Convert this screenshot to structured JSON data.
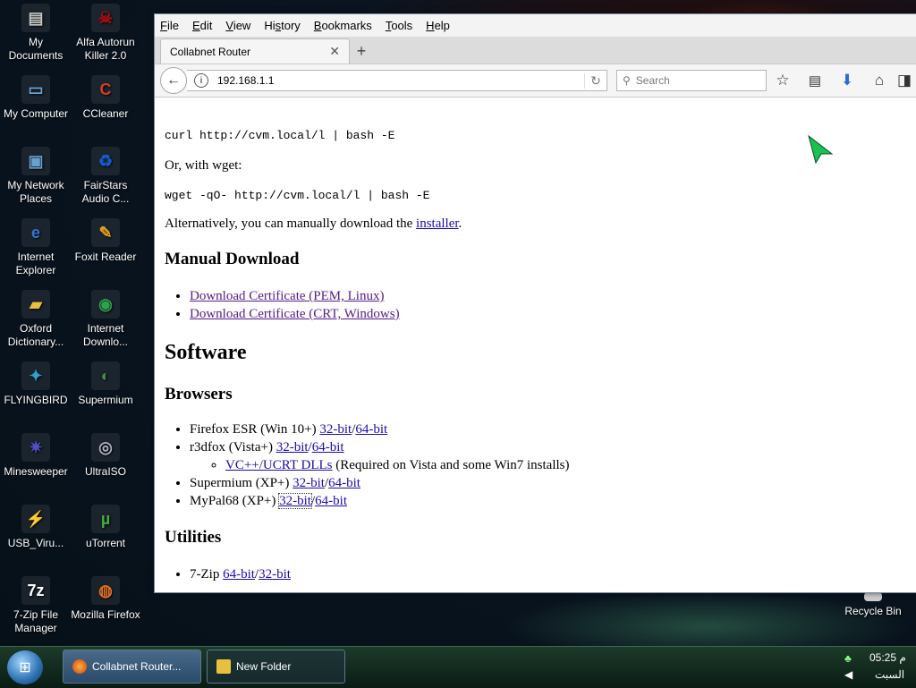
{
  "desktop": {
    "icons": [
      {
        "label": "My Documents",
        "icon": "folder-documents-icon",
        "color": "#c9c9c9"
      },
      {
        "label": "Alfa Autorun Killer 2.0",
        "icon": "virus-killer-icon",
        "color": "#a01010"
      },
      {
        "label": "My Computer",
        "icon": "computer-icon",
        "color": "#6aa0d0"
      },
      {
        "label": "CCleaner",
        "icon": "ccleaner-icon",
        "color": "#d04020"
      },
      {
        "label": "My Network Places",
        "icon": "network-icon",
        "color": "#6aa0d0"
      },
      {
        "label": "FairStars Audio C...",
        "icon": "recycle-audio-icon",
        "color": "#1060d0"
      },
      {
        "label": "Internet Explorer",
        "icon": "internet-explorer-icon",
        "color": "#2a7ad0"
      },
      {
        "label": "Foxit Reader",
        "icon": "foxit-reader-icon",
        "color": "#e0a020"
      },
      {
        "label": "Oxford Dictionary...",
        "icon": "folder-icon",
        "color": "#e8c040"
      },
      {
        "label": "Internet Downlo...",
        "icon": "download-globe-icon",
        "color": "#30a050"
      },
      {
        "label": "FLYINGBIRD",
        "icon": "bird-icon",
        "color": "#30a0d0"
      },
      {
        "label": "Supermium",
        "icon": "supermium-icon",
        "color": "#4a8a4a"
      },
      {
        "label": "Minesweeper",
        "icon": "mine-icon",
        "color": "#5050c0"
      },
      {
        "label": "UltraISO",
        "icon": "disc-icon",
        "color": "#b0b0c0"
      },
      {
        "label": "USB_Viru...",
        "icon": "usb-virus-icon",
        "color": "#c0c0c0"
      },
      {
        "label": "uTorrent",
        "icon": "utorrent-icon",
        "color": "#40b040"
      },
      {
        "label": "7-Zip File Manager",
        "icon": "7zip-icon",
        "color": "#ffffff"
      },
      {
        "label": "Mozilla Firefox",
        "icon": "firefox-icon",
        "color": "#e07020"
      }
    ],
    "recycle_bin": "Recycle Bin"
  },
  "browser": {
    "menu": [
      "File",
      "Edit",
      "View",
      "History",
      "Bookmarks",
      "Tools",
      "Help"
    ],
    "menu_access": [
      "F",
      "E",
      "V",
      "s",
      "B",
      "T",
      "H"
    ],
    "tab_title": "Collabnet Router",
    "url": "192.168.1.1",
    "search_placeholder": "Search"
  },
  "page": {
    "cmd_curl": "curl http://cvm.local/l | bash -E",
    "or_wget": "Or, with wget:",
    "cmd_wget": "wget -qO- http://cvm.local/l | bash -E",
    "alt_text": "Alternatively, you can manually download the ",
    "installer_link": "installer",
    "alt_end": ".",
    "manual_download": "Manual Download",
    "downloads": [
      "Download Certificate (PEM, Linux)",
      "Download Certificate (CRT, Windows)"
    ],
    "software": "Software",
    "browsers": "Browsers",
    "browser_items": [
      {
        "name": "Firefox ESR (Win 10+) ",
        "a": "32-bit",
        "b": "64-bit"
      },
      {
        "name": "r3dfox (Vista+) ",
        "a": "32-bit",
        "b": "64-bit"
      },
      {
        "name": "Supermium (XP+) ",
        "a": "32-bit",
        "b": "64-bit"
      },
      {
        "name": "MyPal68 (XP+) ",
        "a": "32-bit",
        "b": "64-bit"
      }
    ],
    "vcpp_link": "VC++/UCRT DLLs",
    "vcpp_note": " (Required on Vista and some Win7 installs)",
    "utilities": "Utilities",
    "sevenzip": {
      "name": "7-Zip ",
      "a": "64-bit",
      "b": "32-bit"
    },
    "slash": "/"
  },
  "taskbar": {
    "items": [
      "Collabnet Router...",
      "New Folder"
    ],
    "time": "05:25 م",
    "day": "السبت"
  }
}
